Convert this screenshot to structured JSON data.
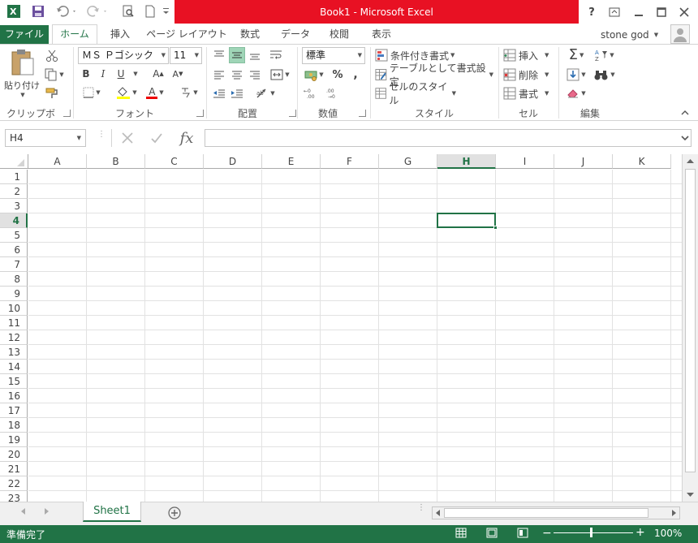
{
  "app": {
    "title": "Book1 - Microsoft Excel",
    "accent": "#217346",
    "title_bar_color": "#e81123"
  },
  "window_buttons": [
    "help-icon",
    "ribbon-display-icon",
    "minimize-icon",
    "maximize-icon",
    "close-icon"
  ],
  "tabs": [
    {
      "label": "ファイル"
    },
    {
      "label": "ホーム"
    },
    {
      "label": "挿入"
    },
    {
      "label": "ページ レイアウト"
    },
    {
      "label": "数式"
    },
    {
      "label": "データ"
    },
    {
      "label": "校閲"
    },
    {
      "label": "表示"
    }
  ],
  "user": {
    "name": "stone god"
  },
  "ribbon": {
    "clipboard": {
      "label": "クリップボード",
      "paste": "貼り付け"
    },
    "font": {
      "label": "フォント",
      "name": "ＭＳ Ｐゴシック",
      "size": "11",
      "bold": "B",
      "italic": "I",
      "underline": "U",
      "grow": "A",
      "shrink": "A",
      "color_a": "A"
    },
    "alignment": {
      "label": "配置"
    },
    "number": {
      "label": "数値",
      "format": "標準",
      "percent": "%",
      "comma": ","
    },
    "styles": {
      "label": "スタイル",
      "conditional": "条件付き書式",
      "table": "テーブルとして書式設定",
      "cell_styles": "セルのスタイル"
    },
    "cells": {
      "label": "セル",
      "insert": "挿入",
      "delete": "削除",
      "format": "書式"
    },
    "editing": {
      "label": "編集"
    }
  },
  "formula_bar": {
    "name_box": "H4",
    "fx": "fx",
    "value": ""
  },
  "columns": [
    "A",
    "B",
    "C",
    "D",
    "E",
    "F",
    "G",
    "H",
    "I",
    "J",
    "K"
  ],
  "rows": [
    "1",
    "2",
    "3",
    "4",
    "5",
    "6",
    "7",
    "8",
    "9",
    "10",
    "11",
    "12",
    "13",
    "14",
    "15",
    "16",
    "17",
    "18",
    "19",
    "20",
    "21",
    "22",
    "23"
  ],
  "selected": {
    "col": "H",
    "row": "4"
  },
  "sheets": [
    {
      "label": "Sheet1"
    }
  ],
  "status": {
    "text": "準備完了",
    "zoom": "100%"
  }
}
